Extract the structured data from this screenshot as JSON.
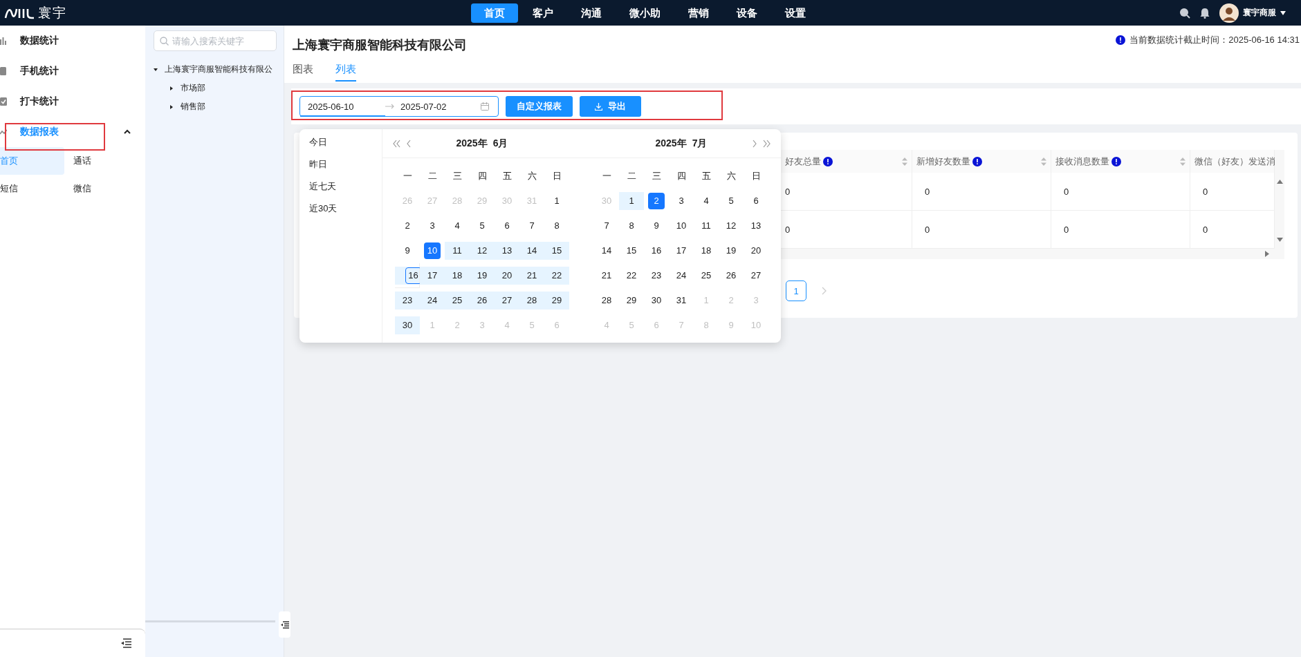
{
  "topbar": {
    "logo_text": "寰宇",
    "nav": [
      {
        "label": "首页",
        "selected": true
      },
      {
        "label": "客户",
        "selected": false
      },
      {
        "label": "沟通",
        "selected": false
      },
      {
        "label": "微小助",
        "selected": false
      },
      {
        "label": "营销",
        "selected": false
      },
      {
        "label": "设备",
        "selected": false
      },
      {
        "label": "设置",
        "selected": false
      }
    ],
    "user": {
      "name": "寰宇商服"
    }
  },
  "sidebar": {
    "items": [
      {
        "label": "数据统计",
        "kind": "bar-chart",
        "selected": false,
        "highlighted": false
      },
      {
        "label": "手机统计",
        "kind": "phone",
        "selected": false,
        "highlighted": false
      },
      {
        "label": "打卡统计",
        "kind": "checkbox",
        "selected": false,
        "highlighted": false
      },
      {
        "label": "数据报表",
        "kind": "line-chart",
        "selected": true,
        "highlighted": true,
        "expanded": true,
        "children": [
          {
            "label": "首页",
            "selected": true
          },
          {
            "label": "通话",
            "selected": false
          },
          {
            "label": "短信",
            "selected": false
          },
          {
            "label": "微信",
            "selected": false
          }
        ]
      }
    ]
  },
  "tree": {
    "search": {
      "placeholder": "请输入搜索关键字"
    },
    "nodes": [
      {
        "label": "上海寰宇商服智能科技有限公",
        "expanded": true,
        "children": [
          {
            "label": "市场部",
            "expanded": false
          },
          {
            "label": "销售部",
            "expanded": false
          }
        ]
      }
    ]
  },
  "main": {
    "title": "上海寰宇商服智能科技有限公司",
    "updated": "当前数据统计截止时间：2025-06-16 14:31",
    "tabs": [
      {
        "label": "图表",
        "selected": false
      },
      {
        "label": "列表",
        "selected": true
      }
    ],
    "toolbar": {
      "highlighted": true,
      "date_range": {
        "start": "2025-06-10",
        "end": "2025-07-02",
        "start_active": true
      },
      "buttons": [
        {
          "label": "自定义报表",
          "kind": "text"
        },
        {
          "label": "导出",
          "kind": "download"
        }
      ]
    },
    "calendar": {
      "presets": [
        "今日",
        "昨日",
        "近七天",
        "近30天"
      ],
      "panels": [
        {
          "year": "2025年",
          "month": "6月",
          "weekdays": [
            "一",
            "二",
            "三",
            "四",
            "五",
            "六",
            "日"
          ],
          "days": [
            {
              "day": "26",
              "muted": true,
              "in_range": false,
              "selected": false,
              "today": false
            },
            {
              "day": "27",
              "muted": true,
              "in_range": false,
              "selected": false,
              "today": false
            },
            {
              "day": "28",
              "muted": true,
              "in_range": false,
              "selected": false,
              "today": false
            },
            {
              "day": "29",
              "muted": true,
              "in_range": false,
              "selected": false,
              "today": false
            },
            {
              "day": "30",
              "muted": true,
              "in_range": false,
              "selected": false,
              "today": false
            },
            {
              "day": "31",
              "muted": true,
              "in_range": false,
              "selected": false,
              "today": false
            },
            {
              "day": "1",
              "muted": false,
              "in_range": false,
              "selected": false,
              "today": false
            },
            {
              "day": "2",
              "muted": false,
              "in_range": false,
              "selected": false,
              "today": false
            },
            {
              "day": "3",
              "muted": false,
              "in_range": false,
              "selected": false,
              "today": false
            },
            {
              "day": "4",
              "muted": false,
              "in_range": false,
              "selected": false,
              "today": false
            },
            {
              "day": "5",
              "muted": false,
              "in_range": false,
              "selected": false,
              "today": false
            },
            {
              "day": "6",
              "muted": false,
              "in_range": false,
              "selected": false,
              "today": false
            },
            {
              "day": "7",
              "muted": false,
              "in_range": false,
              "selected": false,
              "today": false
            },
            {
              "day": "8",
              "muted": false,
              "in_range": false,
              "selected": false,
              "today": false
            },
            {
              "day": "9",
              "muted": false,
              "in_range": false,
              "selected": false,
              "today": false
            },
            {
              "day": "10",
              "muted": false,
              "in_range": false,
              "selected": true,
              "today": false
            },
            {
              "day": "11",
              "muted": false,
              "in_range": true,
              "selected": false,
              "today": false
            },
            {
              "day": "12",
              "muted": false,
              "in_range": true,
              "selected": false,
              "today": false
            },
            {
              "day": "13",
              "muted": false,
              "in_range": true,
              "selected": false,
              "today": false
            },
            {
              "day": "14",
              "muted": false,
              "in_range": true,
              "selected": false,
              "today": false
            },
            {
              "day": "15",
              "muted": false,
              "in_range": true,
              "selected": false,
              "today": false
            },
            {
              "day": "16",
              "muted": false,
              "in_range": true,
              "selected": false,
              "today": true
            },
            {
              "day": "17",
              "muted": false,
              "in_range": true,
              "selected": false,
              "today": false
            },
            {
              "day": "18",
              "muted": false,
              "in_range": true,
              "selected": false,
              "today": false
            },
            {
              "day": "19",
              "muted": false,
              "in_range": true,
              "selected": false,
              "today": false
            },
            {
              "day": "20",
              "muted": false,
              "in_range": true,
              "selected": false,
              "today": false
            },
            {
              "day": "21",
              "muted": false,
              "in_range": true,
              "selected": false,
              "today": false
            },
            {
              "day": "22",
              "muted": false,
              "in_range": true,
              "selected": false,
              "today": false
            },
            {
              "day": "23",
              "muted": false,
              "in_range": true,
              "selected": false,
              "today": false
            },
            {
              "day": "24",
              "muted": false,
              "in_range": true,
              "selected": false,
              "today": false
            },
            {
              "day": "25",
              "muted": false,
              "in_range": true,
              "selected": false,
              "today": false
            },
            {
              "day": "26",
              "muted": false,
              "in_range": true,
              "selected": false,
              "today": false
            },
            {
              "day": "27",
              "muted": false,
              "in_range": true,
              "selected": false,
              "today": false
            },
            {
              "day": "28",
              "muted": false,
              "in_range": true,
              "selected": false,
              "today": false
            },
            {
              "day": "29",
              "muted": false,
              "in_range": true,
              "selected": false,
              "today": false
            },
            {
              "day": "30",
              "muted": false,
              "in_range": true,
              "selected": false,
              "today": false
            },
            {
              "day": "1",
              "muted": true,
              "in_range": false,
              "selected": false,
              "today": false
            },
            {
              "day": "2",
              "muted": true,
              "in_range": false,
              "selected": false,
              "today": false
            },
            {
              "day": "3",
              "muted": true,
              "in_range": false,
              "selected": false,
              "today": false
            },
            {
              "day": "4",
              "muted": true,
              "in_range": false,
              "selected": false,
              "today": false
            },
            {
              "day": "5",
              "muted": true,
              "in_range": false,
              "selected": false,
              "today": false
            },
            {
              "day": "6",
              "muted": true,
              "in_range": false,
              "selected": false,
              "today": false
            }
          ]
        },
        {
          "year": "2025年",
          "month": "7月",
          "weekdays": [
            "一",
            "二",
            "三",
            "四",
            "五",
            "六",
            "日"
          ],
          "days": [
            {
              "day": "30",
              "muted": true,
              "in_range": false,
              "selected": false,
              "today": false
            },
            {
              "day": "1",
              "muted": false,
              "in_range": true,
              "selected": false,
              "today": false
            },
            {
              "day": "2",
              "muted": false,
              "in_range": false,
              "selected": true,
              "today": false
            },
            {
              "day": "3",
              "muted": false,
              "in_range": false,
              "selected": false,
              "today": false
            },
            {
              "day": "4",
              "muted": false,
              "in_range": false,
              "selected": false,
              "today": false
            },
            {
              "day": "5",
              "muted": false,
              "in_range": false,
              "selected": false,
              "today": false
            },
            {
              "day": "6",
              "muted": false,
              "in_range": false,
              "selected": false,
              "today": false
            },
            {
              "day": "7",
              "muted": false,
              "in_range": false,
              "selected": false,
              "today": false
            },
            {
              "day": "8",
              "muted": false,
              "in_range": false,
              "selected": false,
              "today": false
            },
            {
              "day": "9",
              "muted": false,
              "in_range": false,
              "selected": false,
              "today": false
            },
            {
              "day": "10",
              "muted": false,
              "in_range": false,
              "selected": false,
              "today": false
            },
            {
              "day": "11",
              "muted": false,
              "in_range": false,
              "selected": false,
              "today": false
            },
            {
              "day": "12",
              "muted": false,
              "in_range": false,
              "selected": false,
              "today": false
            },
            {
              "day": "13",
              "muted": false,
              "in_range": false,
              "selected": false,
              "today": false
            },
            {
              "day": "14",
              "muted": false,
              "in_range": false,
              "selected": false,
              "today": false
            },
            {
              "day": "15",
              "muted": false,
              "in_range": false,
              "selected": false,
              "today": false
            },
            {
              "day": "16",
              "muted": false,
              "in_range": false,
              "selected": false,
              "today": false
            },
            {
              "day": "17",
              "muted": false,
              "in_range": false,
              "selected": false,
              "today": false
            },
            {
              "day": "18",
              "muted": false,
              "in_range": false,
              "selected": false,
              "today": false
            },
            {
              "day": "19",
              "muted": false,
              "in_range": false,
              "selected": false,
              "today": false
            },
            {
              "day": "20",
              "muted": false,
              "in_range": false,
              "selected": false,
              "today": false
            },
            {
              "day": "21",
              "muted": false,
              "in_range": false,
              "selected": false,
              "today": false
            },
            {
              "day": "22",
              "muted": false,
              "in_range": false,
              "selected": false,
              "today": false
            },
            {
              "day": "23",
              "muted": false,
              "in_range": false,
              "selected": false,
              "today": false
            },
            {
              "day": "24",
              "muted": false,
              "in_range": false,
              "selected": false,
              "today": false
            },
            {
              "day": "25",
              "muted": false,
              "in_range": false,
              "selected": false,
              "today": false
            },
            {
              "day": "26",
              "muted": false,
              "in_range": false,
              "selected": false,
              "today": false
            },
            {
              "day": "27",
              "muted": false,
              "in_range": false,
              "selected": false,
              "today": false
            },
            {
              "day": "28",
              "muted": false,
              "in_range": false,
              "selected": false,
              "today": false
            },
            {
              "day": "29",
              "muted": false,
              "in_range": false,
              "selected": false,
              "today": false
            },
            {
              "day": "30",
              "muted": false,
              "in_range": false,
              "selected": false,
              "today": false
            },
            {
              "day": "31",
              "muted": false,
              "in_range": false,
              "selected": false,
              "today": false
            },
            {
              "day": "1",
              "muted": true,
              "in_range": false,
              "selected": false,
              "today": false
            },
            {
              "day": "2",
              "muted": true,
              "in_range": false,
              "selected": false,
              "today": false
            },
            {
              "day": "3",
              "muted": true,
              "in_range": false,
              "selected": false,
              "today": false
            },
            {
              "day": "4",
              "muted": true,
              "in_range": false,
              "selected": false,
              "today": false
            },
            {
              "day": "5",
              "muted": true,
              "in_range": false,
              "selected": false,
              "today": false
            },
            {
              "day": "6",
              "muted": true,
              "in_range": false,
              "selected": false,
              "today": false
            },
            {
              "day": "7",
              "muted": true,
              "in_range": false,
              "selected": false,
              "today": false
            },
            {
              "day": "8",
              "muted": true,
              "in_range": false,
              "selected": false,
              "today": false
            },
            {
              "day": "9",
              "muted": true,
              "in_range": false,
              "selected": false,
              "today": false
            },
            {
              "day": "10",
              "muted": true,
              "in_range": false,
              "selected": false,
              "today": false
            }
          ]
        }
      ]
    },
    "table": {
      "columns": [
        {
          "label": "好友总量",
          "info": true,
          "sortable": true
        },
        {
          "label": "新增好友数量",
          "info": true,
          "sortable": true
        },
        {
          "label": "接收消息数量",
          "info": true,
          "sortable": true
        },
        {
          "label": "微信（好友）发送消"
        }
      ],
      "rows": [
        [
          "0",
          "0",
          "0",
          "0"
        ],
        [
          "0",
          "0",
          "0",
          "0"
        ]
      ]
    },
    "pagination": {
      "pages": [
        {
          "label": "1",
          "selected": true
        }
      ]
    }
  }
}
